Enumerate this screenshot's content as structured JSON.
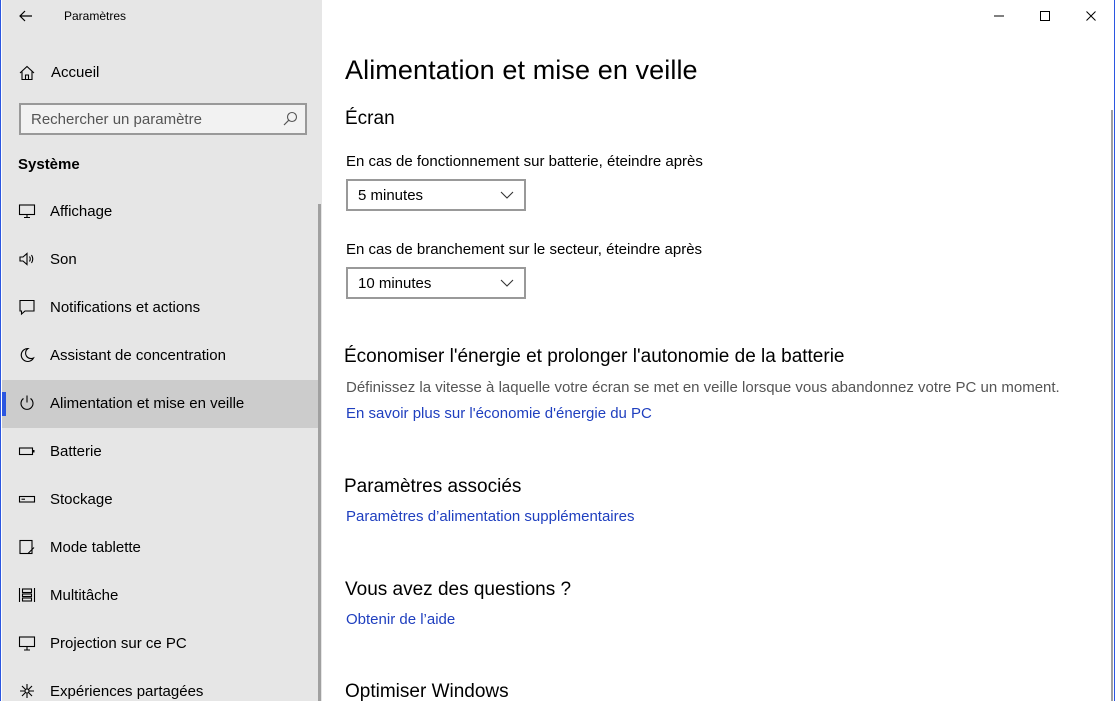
{
  "window": {
    "title": "Paramètres"
  },
  "sidebar": {
    "home_label": "Accueil",
    "search_placeholder": "Rechercher un paramètre",
    "section_label": "Système",
    "items": [
      {
        "label": "Affichage",
        "icon": "monitor-icon"
      },
      {
        "label": "Son",
        "icon": "speaker-icon"
      },
      {
        "label": "Notifications et actions",
        "icon": "notification-icon"
      },
      {
        "label": "Assistant de concentration",
        "icon": "moon-icon"
      },
      {
        "label": "Alimentation et mise en veille",
        "icon": "power-icon",
        "active": true
      },
      {
        "label": "Batterie",
        "icon": "battery-icon"
      },
      {
        "label": "Stockage",
        "icon": "storage-icon"
      },
      {
        "label": "Mode tablette",
        "icon": "tablet-icon"
      },
      {
        "label": "Multitâche",
        "icon": "multitask-icon"
      },
      {
        "label": "Projection sur ce PC",
        "icon": "projection-icon"
      },
      {
        "label": "Expériences partagées",
        "icon": "shared-experiences-icon"
      }
    ]
  },
  "main": {
    "title": "Alimentation et mise en veille",
    "screen": {
      "heading": "Écran",
      "battery_label": "En cas de fonctionnement sur batterie, éteindre après",
      "battery_value": "5 minutes",
      "plugged_label": "En cas de branchement sur le secteur, éteindre après",
      "plugged_value": "10 minutes"
    },
    "save_energy": {
      "heading": "Économiser l'énergie et prolonger l'autonomie de la batterie",
      "description": "Définissez la vitesse à laquelle votre écran se met en veille lorsque vous abandonnez votre PC un moment.",
      "link": "En savoir plus sur l'économie d'énergie du PC"
    },
    "related": {
      "heading": "Paramètres associés",
      "link": "Paramètres d’alimentation supplémentaires"
    },
    "questions": {
      "heading": "Vous avez des questions ?",
      "link": "Obtenir de l’aide"
    },
    "optimize": {
      "heading": "Optimiser Windows"
    }
  },
  "colors": {
    "accent": "#2b56e0",
    "link": "#1f3fbf",
    "sidebar_bg": "#e6e6e6"
  }
}
